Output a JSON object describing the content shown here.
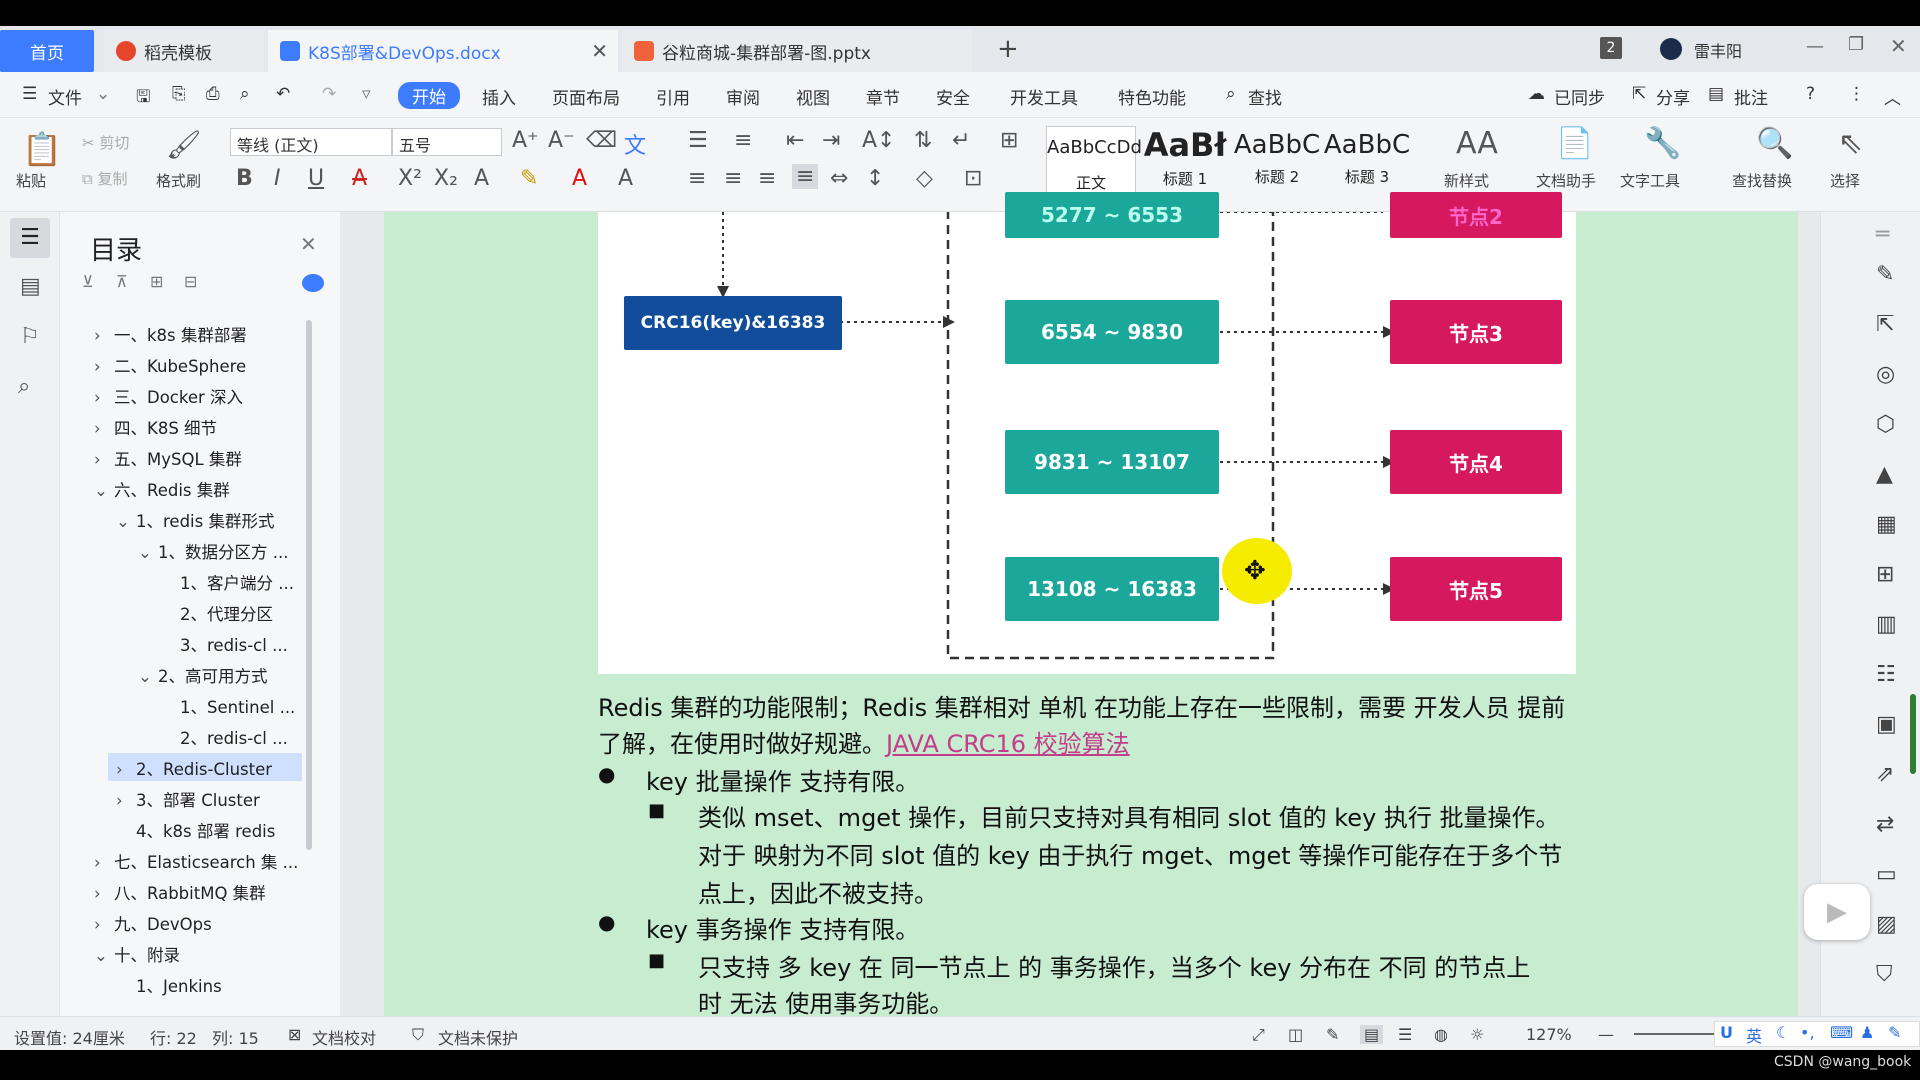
{
  "tabs": {
    "home": "首页",
    "t1": "稻壳模板",
    "t2": "K8S部署&DevOps.docx",
    "t3": "谷粒商城-集群部署-图.pptx",
    "badge": "2",
    "user": "雷丰阳"
  },
  "menu": {
    "file": "文件",
    "start": "开始",
    "insert": "插入",
    "layout": "页面布局",
    "ref": "引用",
    "review": "审阅",
    "view": "视图",
    "chapter": "章节",
    "security": "安全",
    "dev": "开发工具",
    "feature": "特色功能",
    "search": "查找",
    "synced": "已同步",
    "share": "分享",
    "comment": "批注"
  },
  "ribbon": {
    "paste": "粘贴",
    "cut": "剪切",
    "copy": "复制",
    "format_painter": "格式刷",
    "font_name": "等线 (正文)",
    "font_size": "五号",
    "style_normal_preview": "AaBbCcDd",
    "style_normal": "正文",
    "style_h1_preview": "AaBł",
    "style_h1": "标题 1",
    "style_h2_preview": "AaBbC",
    "style_h2": "标题 2",
    "style_h3_preview": "AaBbC",
    "style_h3": "标题 3",
    "new_style": "新样式",
    "doc_helper": "文档助手",
    "text_tools": "文字工具",
    "find_replace": "查找替换",
    "select": "选择"
  },
  "toc": {
    "title": "目录",
    "items": [
      {
        "label": "一、k8s 集群部署"
      },
      {
        "label": "二、KubeSphere"
      },
      {
        "label": "三、Docker 深入"
      },
      {
        "label": "四、K8S 细节"
      },
      {
        "label": "五、MySQL 集群"
      },
      {
        "label": "六、Redis 集群"
      },
      {
        "label": "1、redis 集群形式"
      },
      {
        "label": "1、数据分区方 ..."
      },
      {
        "label": "1、客户端分 ..."
      },
      {
        "label": "2、代理分区"
      },
      {
        "label": "3、redis-cl ..."
      },
      {
        "label": "2、高可用方式"
      },
      {
        "label": "1、Sentinel ..."
      },
      {
        "label": "2、redis-cl ..."
      },
      {
        "label": "2、Redis-Cluster"
      },
      {
        "label": "3、部署 Cluster"
      },
      {
        "label": "4、k8s 部署 redis"
      },
      {
        "label": "七、Elasticsearch 集 ..."
      },
      {
        "label": "八、RabbitMQ 集群"
      },
      {
        "label": "九、DevOps"
      },
      {
        "label": "十、附录"
      },
      {
        "label": "1、Jenkins"
      }
    ]
  },
  "diagram": {
    "crc": "CRC16(key)&16383",
    "slot0": "5277 ~ 6553",
    "slot1": "6554 ~ 9830",
    "slot2": "9831 ~ 13107",
    "slot3": "13108 ~ 16383",
    "node0": "节点2",
    "node1": "节点3",
    "node2": "节点4",
    "node3": "节点5"
  },
  "doc": {
    "p1a": "Redis 集群的功能限制；Redis  集群相对 单机 在功能上存在一些限制，需要 开发人员 提前",
    "p1b": "了解，在使用时做好规避。",
    "link": "JAVA CRC16 校验算法",
    "b1": "key 批量操作 支持有限。",
    "b1s1": "类似  mset、mget  操作，目前只支持对具有相同  slot  值的  key  执行 批量操作。",
    "b1s2": "对于 映射为不同 slot  值的  key  由于执行  mget、mget  等操作可能存在于多个节",
    "b1s3": "点上，因此不被支持。",
    "b2": "key 事务操作 支持有限。",
    "b2s1": "只支持 多 key  在 同一节点上 的 事务操作，当多个  key  分布在 不同 的节点上",
    "b2s2": "时 无法 使用事务功能。"
  },
  "status": {
    "setting": "设置值: 24厘米",
    "row": "行: 22",
    "col": "列: 15",
    "proof": "文档校对",
    "protect": "文档未保护",
    "zoom": "127%",
    "ime": "英",
    "watermark": "CSDN @wang_book"
  }
}
